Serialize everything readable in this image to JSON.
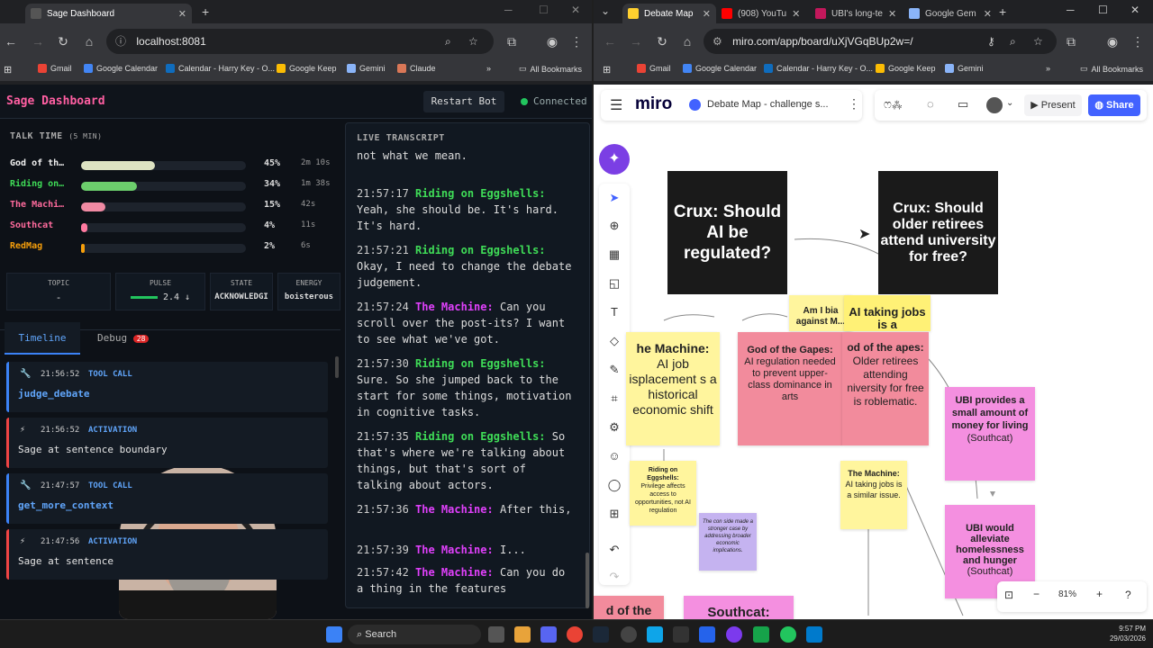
{
  "left_browser": {
    "tab_title": "Sage Dashboard",
    "url": "localhost:8081",
    "bookmarks": [
      "Gmail",
      "Google Calendar",
      "Calendar - Harry Key - O...",
      "Google Keep",
      "Gemini",
      "Claude"
    ],
    "all_bookmarks": "All Bookmarks"
  },
  "sage": {
    "title": "Sage Dashboard",
    "restart_label": "Restart Bot",
    "status": "Connected",
    "talk_time_title": "TALK TIME",
    "talk_time_window": "(5 MIN)",
    "speakers": [
      {
        "name": "God of th…",
        "pct": "45%",
        "fraction": 0.45,
        "dur": "2m 10s",
        "color": "#dde3c2",
        "name_color": "#f1f1f1"
      },
      {
        "name": "Riding on…",
        "pct": "34%",
        "fraction": 0.34,
        "dur": "1m 38s",
        "color": "#6ccf6c",
        "name_color": "#3fdc57"
      },
      {
        "name": "The Machi…",
        "pct": "15%",
        "fraction": 0.15,
        "dur": "42s",
        "color": "#f08aa3",
        "name_color": "#ff6b9d"
      },
      {
        "name": "Southcat",
        "pct": "4%",
        "fraction": 0.04,
        "dur": "11s",
        "color": "#ff7aa0",
        "name_color": "#ff6b9d"
      },
      {
        "name": "RedMag",
        "pct": "2%",
        "fraction": 0.02,
        "dur": "6s",
        "color": "#f59e0b",
        "name_color": "#f59e0b"
      }
    ],
    "stats": [
      {
        "label": "TOPIC",
        "value": "-"
      },
      {
        "label": "PULSE",
        "value": "2.4 ↓"
      },
      {
        "label": "STATE",
        "value": "ACKNOWLEDGI"
      },
      {
        "label": "ENERGY",
        "value": "boisterous"
      }
    ],
    "tabs": {
      "timeline": "Timeline",
      "debug": "Debug",
      "debug_count": "28"
    },
    "timeline": [
      {
        "icon": "🔧",
        "time": "21:56:52",
        "kind": "TOOL CALL",
        "text": "judge_debate",
        "type": "tool"
      },
      {
        "icon": "⚡",
        "time": "21:56:52",
        "kind": "ACTIVATION",
        "text": "Sage at sentence boundary",
        "type": "act"
      },
      {
        "icon": "🔧",
        "time": "21:47:57",
        "kind": "TOOL CALL",
        "text": "get_more_context",
        "type": "tool"
      },
      {
        "icon": "⚡",
        "time": "21:47:56",
        "kind": "ACTIVATION",
        "text": "Sage at sentence",
        "type": "act"
      }
    ],
    "transcript_title": "LIVE TRANSCRIPT",
    "transcript": [
      {
        "time": "",
        "speaker": "",
        "text": "not what we mean."
      },
      {
        "time": "21:57:17",
        "speaker": "Riding on Eggshells:",
        "sp": "g",
        "text": "Yeah, she should be. It's hard. It's hard."
      },
      {
        "time": "21:57:21",
        "speaker": "Riding on Eggshells:",
        "sp": "g",
        "text": "Okay, I need to change the debate judgement."
      },
      {
        "time": "21:57:24",
        "speaker": "The Machine:",
        "sp": "m",
        "text": "Can you scroll over the post-its? I want to see what we've got."
      },
      {
        "time": "21:57:30",
        "speaker": "Riding on Eggshells:",
        "sp": "g",
        "text": "Sure. So she jumped back to the start for some things, motivation in cognitive tasks."
      },
      {
        "time": "21:57:35",
        "speaker": "Riding on Eggshells:",
        "sp": "g",
        "text": "So that's where we're talking about things, but that's sort of talking about actors."
      },
      {
        "time": "21:57:36",
        "speaker": "The Machine:",
        "sp": "m",
        "text": "After this,"
      },
      {
        "time": "21:57:39",
        "speaker": "The Machine:",
        "sp": "m",
        "text": "I..."
      },
      {
        "time": "21:57:42",
        "speaker": "The Machine:",
        "sp": "m",
        "text": "Can you do a thing in the features"
      }
    ]
  },
  "right_browser": {
    "tabs": [
      "Debate Map",
      "(908) YouTu",
      "UBI's long-te",
      "Google Gem"
    ],
    "url": "miro.com/app/board/uXjVGqBUp2w=/",
    "bookmarks": [
      "Gmail",
      "Google Calendar",
      "Calendar - Harry Key - O...",
      "Google Keep",
      "Gemini"
    ],
    "all_bookmarks": "All Bookmarks"
  },
  "miro": {
    "logo": "miro",
    "board_name": "Debate Map - challenge s...",
    "present_label": "Present",
    "share_label": "Share",
    "zoom": "81%",
    "cards": [
      {
        "text": "Crux: Should AI be regulated?"
      },
      {
        "text": "Crux: Should older retirees attend university for free?"
      }
    ],
    "stickies": {
      "machine_ai": {
        "head": "he Machine:",
        "body": "AI job isplacement s a historical economic shift"
      },
      "god_ai": {
        "head": "God of the Gapes:",
        "body": "AI regulation needed to prevent upper-class dominance in arts"
      },
      "bias": {
        "text": "Am I bia against M..."
      },
      "ai_taking": {
        "text": "AI taking jobs is a"
      },
      "god_retirees": {
        "head": "od of the apes:",
        "body": "Older retirees attending niversity for free is roblematic."
      },
      "riding": {
        "head": "Riding on Eggshells:",
        "body": "Privilege affects access to opportunities, not AI regulation"
      },
      "con_side": {
        "text": "The con side made a stronger case by addressing broader economic implications."
      },
      "machine_ai2": {
        "head": "The Machine:",
        "body": "AI taking jobs is a similar issue."
      },
      "ubi1": {
        "head": "UBI provides a small amount of money for living",
        "body": "(Southcat)"
      },
      "ubi2": {
        "head": "UBI would alleviate homelessness and hunger",
        "body": "(Southcat)"
      },
      "bottom_left": {
        "text": "d of the"
      },
      "southcat": {
        "text": "Southcat:"
      }
    }
  },
  "taskbar": {
    "search": "Search",
    "time": "9:57 PM",
    "date": "29/03/2026"
  }
}
